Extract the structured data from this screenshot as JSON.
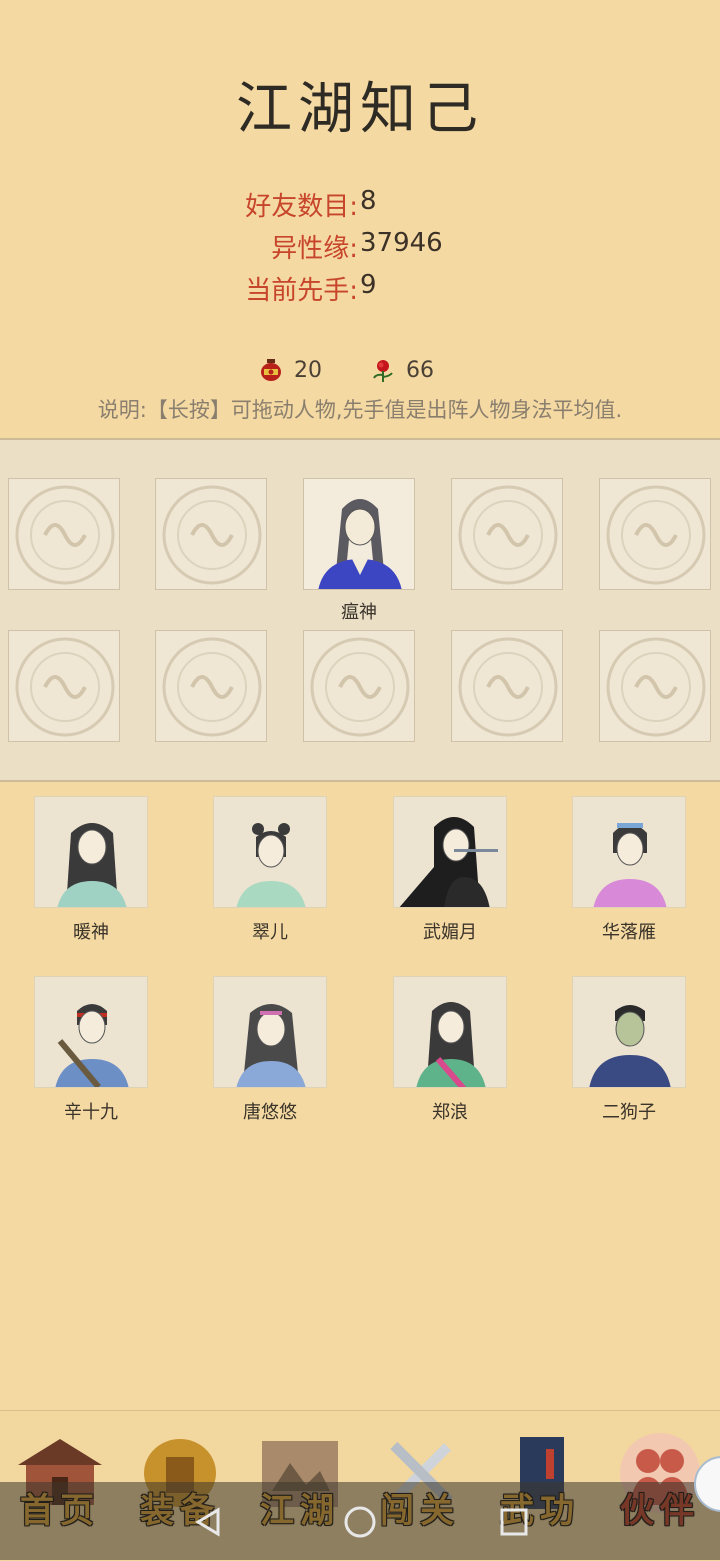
{
  "header": {
    "title": "江湖知己"
  },
  "stats": [
    {
      "label": "好友数目:",
      "value": "8"
    },
    {
      "label": "异性缘:",
      "value": "37946"
    },
    {
      "label": "当前先手:",
      "value": "9"
    }
  ],
  "resources": [
    {
      "icon": "wine-jar-icon",
      "value": "20"
    },
    {
      "icon": "rose-icon",
      "value": "66"
    }
  ],
  "note": "说明:【长按】可拖动人物,先手值是出阵人物身法平均值.",
  "formation": {
    "active_name": "瘟神"
  },
  "roster": [
    {
      "name": "暖神"
    },
    {
      "name": "翠儿"
    },
    {
      "name": "武媚月"
    },
    {
      "name": "华落雁"
    },
    {
      "name": "辛十九"
    },
    {
      "name": "唐悠悠"
    },
    {
      "name": "郑浪"
    },
    {
      "name": "二狗子"
    }
  ],
  "nav": {
    "tabs": [
      {
        "label": "首页",
        "icon": "house-icon"
      },
      {
        "label": "装备",
        "icon": "armor-icon"
      },
      {
        "label": "江湖",
        "icon": "scroll-map-icon"
      },
      {
        "label": "闯关",
        "icon": "crossed-swords-icon"
      },
      {
        "label": "武功",
        "icon": "martial-book-icon"
      },
      {
        "label": "伙伴",
        "icon": "companions-icon"
      }
    ],
    "active": "伙伴"
  },
  "colors": {
    "background": "#f5d9a2",
    "stat_label": "#c7452b",
    "nav_label": "#e0a52f",
    "nav_active": "#c03a20"
  }
}
